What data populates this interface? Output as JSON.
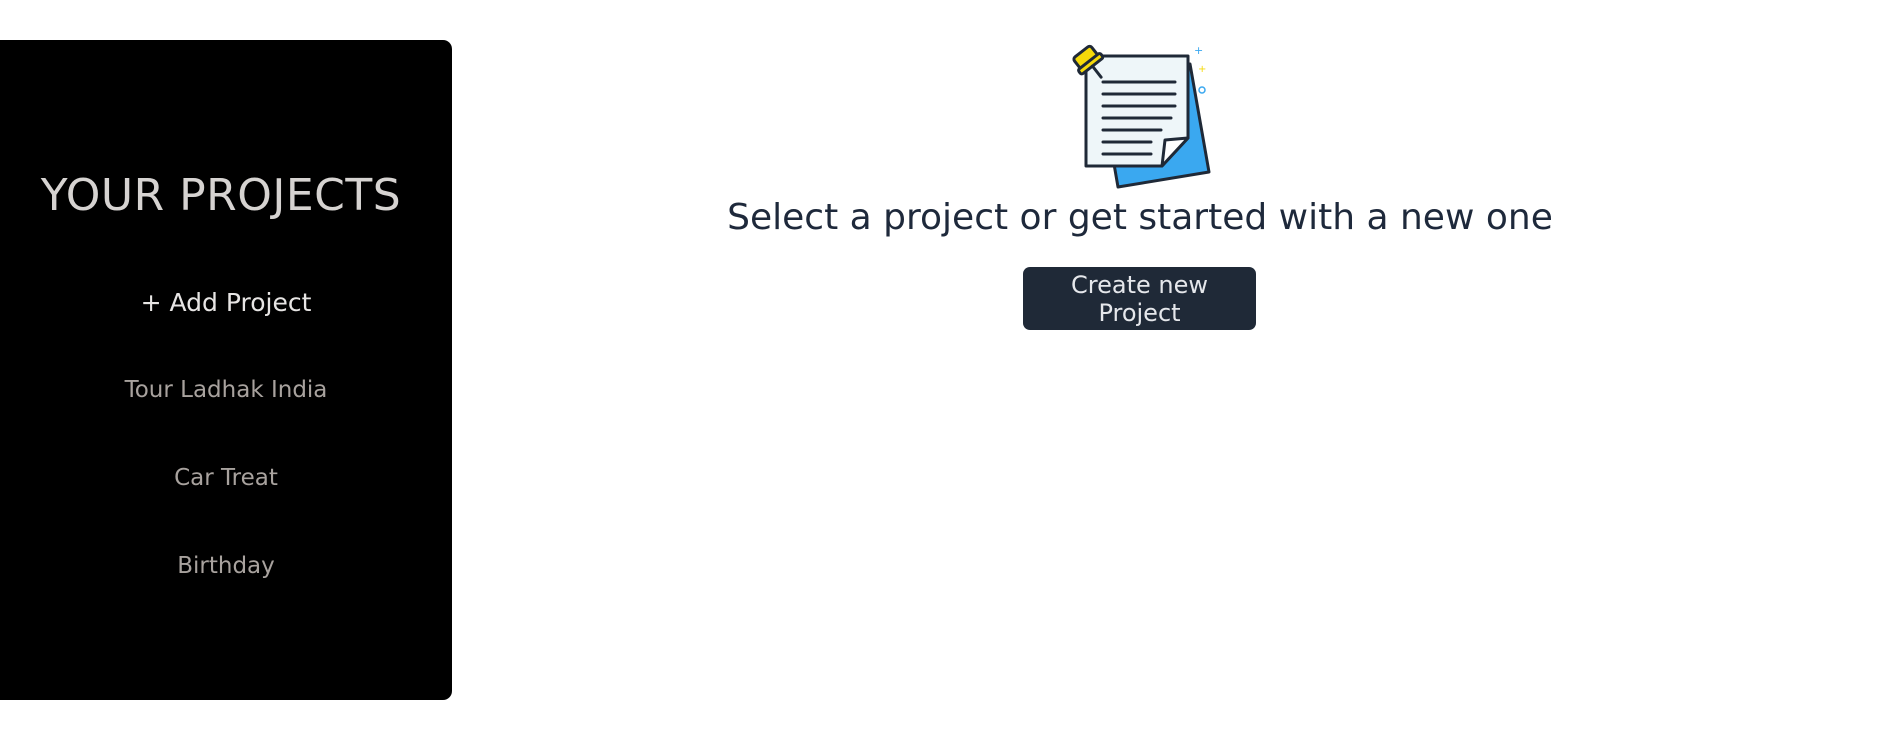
{
  "sidebar": {
    "title": "YOUR PROJECTS",
    "add_project_label": "+ Add Project",
    "projects": [
      {
        "title": "Tour Ladhak India"
      },
      {
        "title": "Car Treat"
      },
      {
        "title": "Birthday"
      }
    ]
  },
  "main": {
    "icon": "document-pin-icon",
    "message": "Select a project or get started with a new one",
    "create_button_label": "Create new Project"
  },
  "colors": {
    "sidebar_bg": "#000000",
    "button_bg": "#1f2937",
    "heading_text": "#1e293b",
    "icon_accent_blue": "#3aa8f0",
    "icon_pin_yellow": "#f5d90a"
  }
}
